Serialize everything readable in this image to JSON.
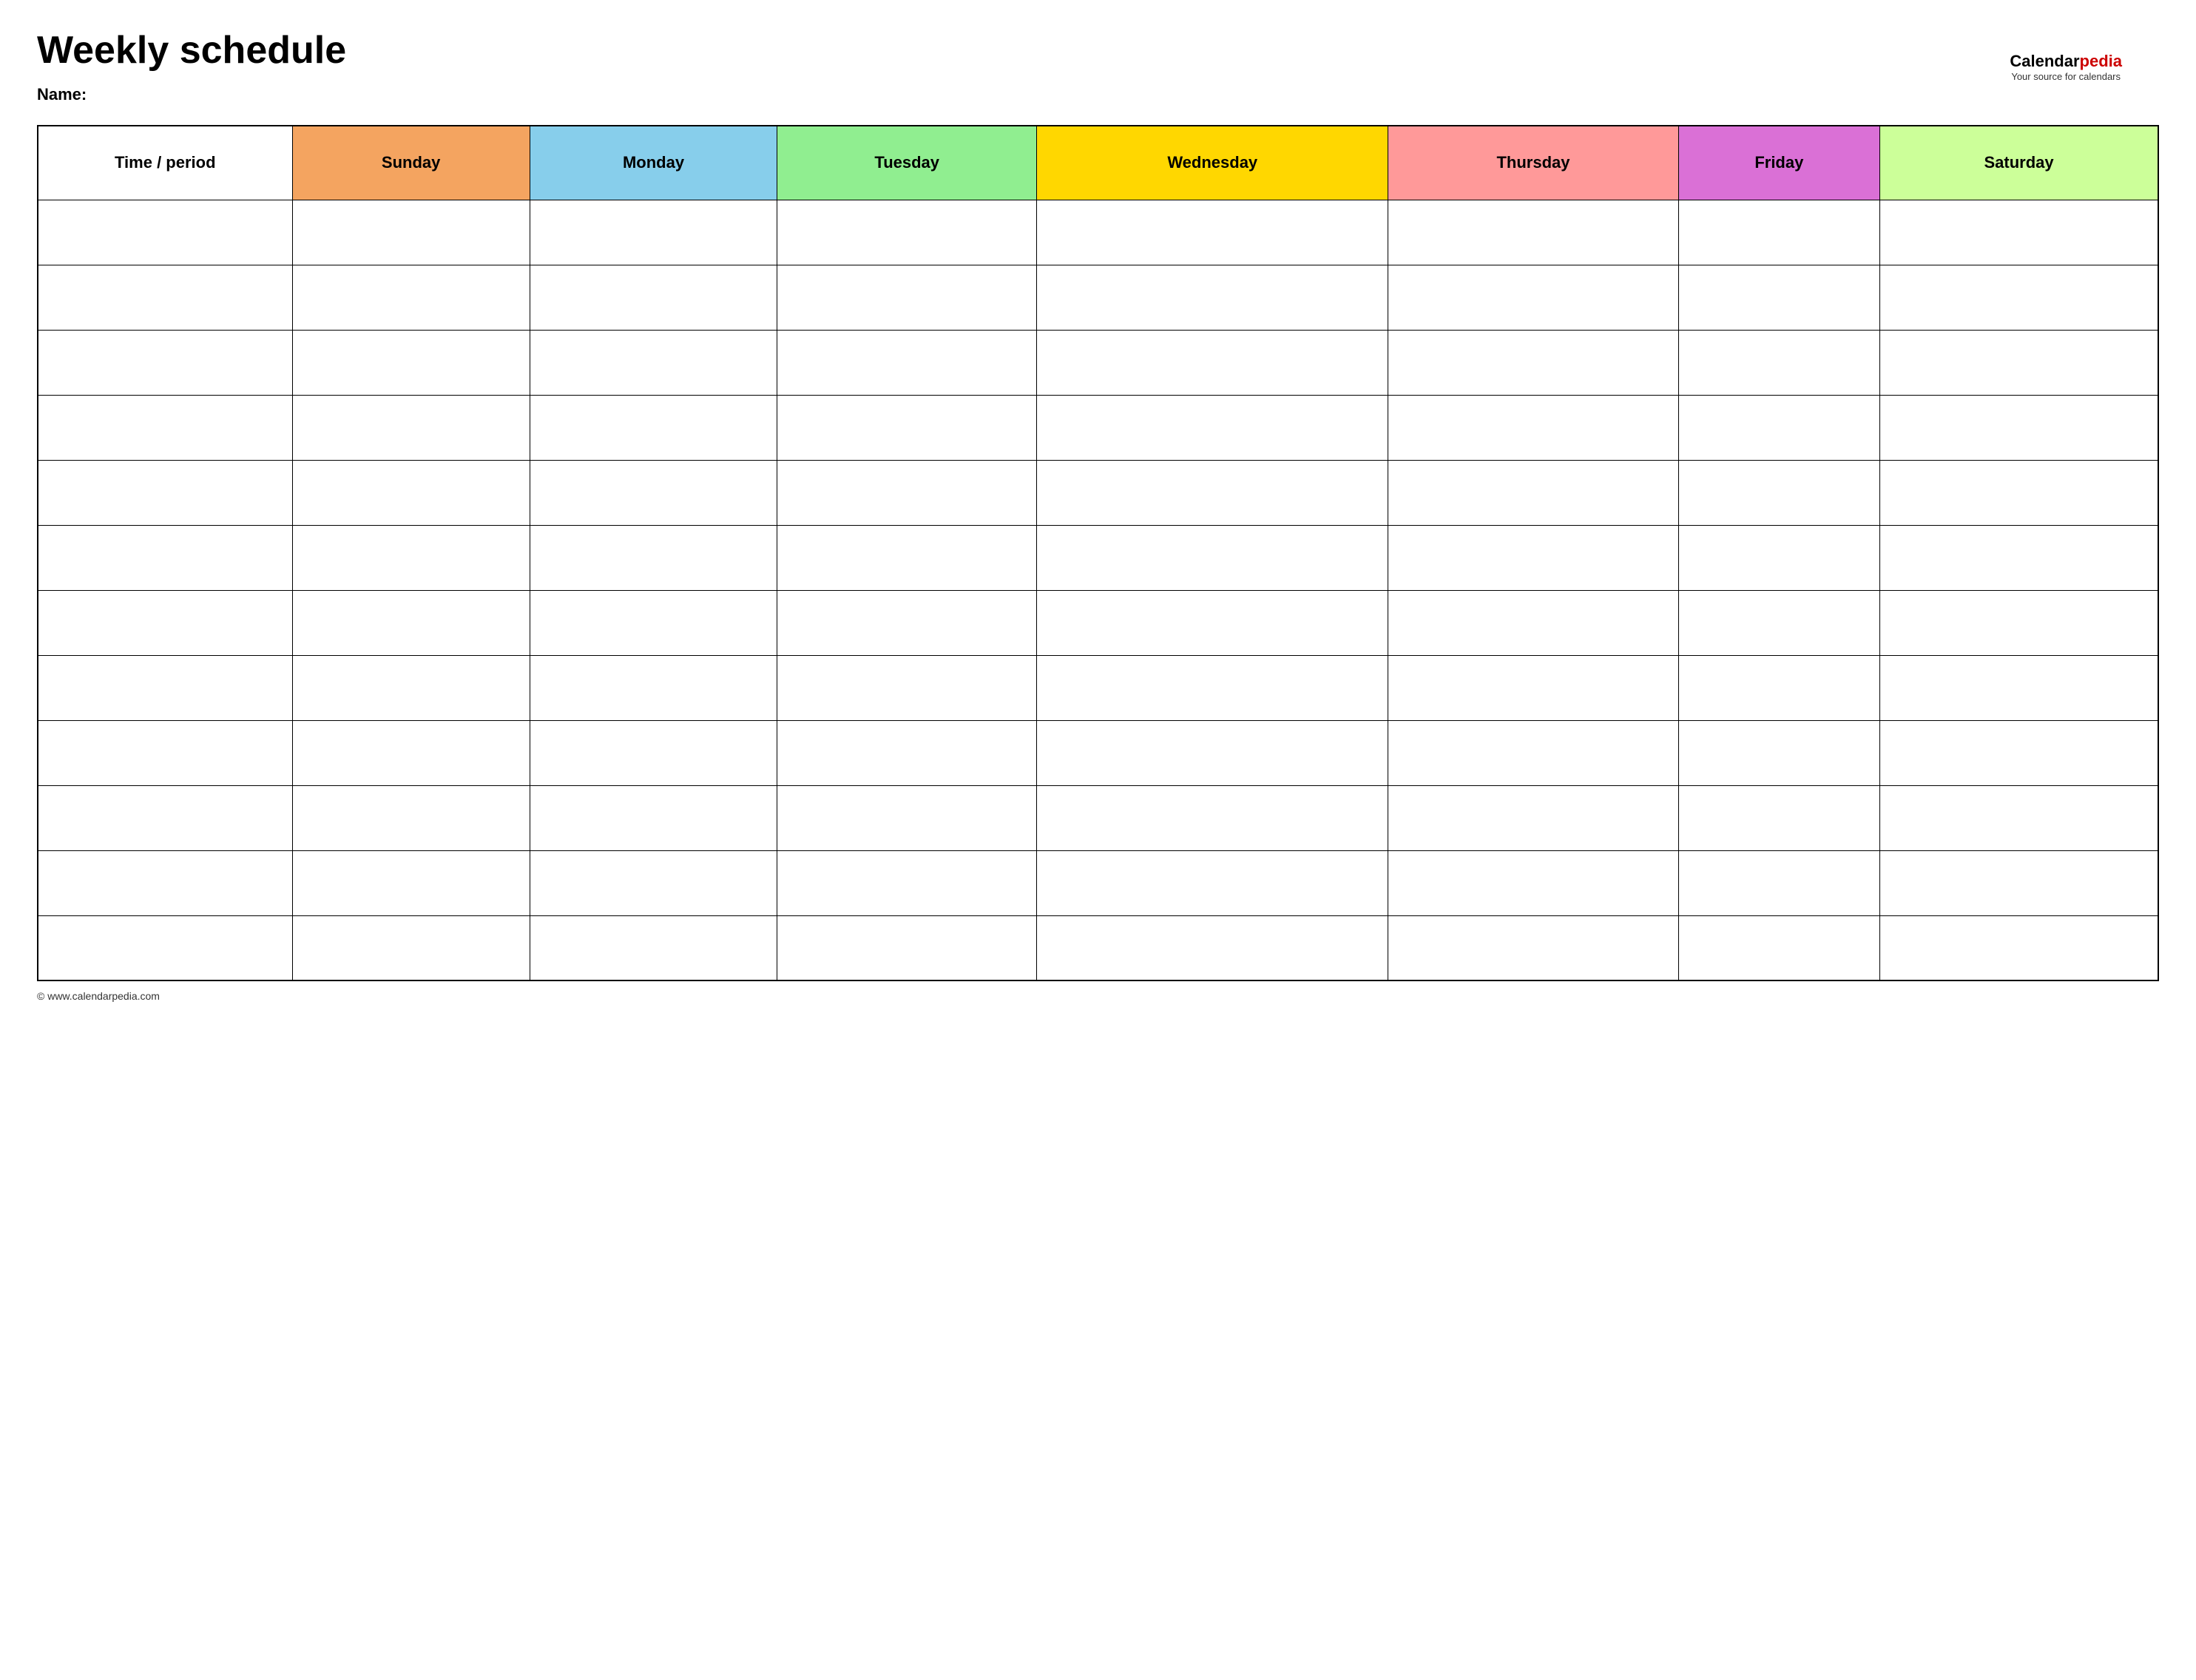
{
  "header": {
    "title": "Weekly schedule",
    "name_label": "Name:",
    "logo_calendar": "Calendar",
    "logo_pedia": "pedia",
    "logo_sub": "Your source for calendars",
    "logo_url": "www.calendarpedia.com"
  },
  "table": {
    "columns": [
      {
        "id": "time",
        "label": "Time / period",
        "class": "th-time"
      },
      {
        "id": "sunday",
        "label": "Sunday",
        "class": "th-sunday"
      },
      {
        "id": "monday",
        "label": "Monday",
        "class": "th-monday"
      },
      {
        "id": "tuesday",
        "label": "Tuesday",
        "class": "th-tuesday"
      },
      {
        "id": "wednesday",
        "label": "Wednesday",
        "class": "th-wednesday"
      },
      {
        "id": "thursday",
        "label": "Thursday",
        "class": "th-thursday"
      },
      {
        "id": "friday",
        "label": "Friday",
        "class": "th-friday"
      },
      {
        "id": "saturday",
        "label": "Saturday",
        "class": "th-saturday"
      }
    ],
    "row_count": 12
  },
  "footer": {
    "url": "© www.calendarpedia.com"
  }
}
